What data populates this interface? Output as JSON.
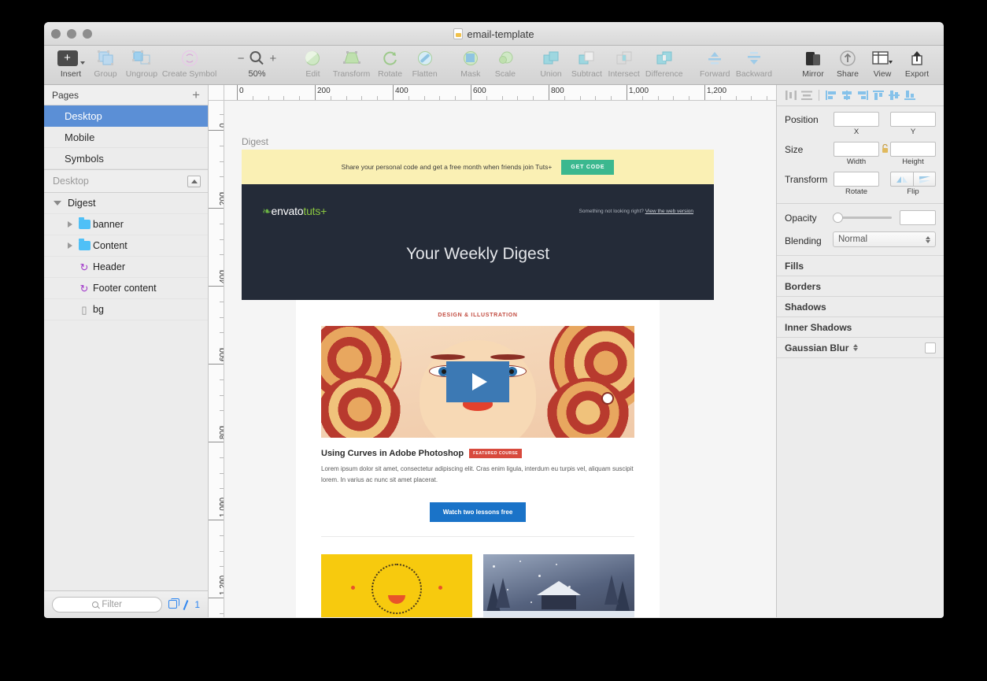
{
  "window": {
    "title": "email-template",
    "doc_icon": "sketch-document-icon"
  },
  "toolbar": {
    "items": [
      {
        "label": "Insert",
        "icon": "plus-insert-icon",
        "dim": false
      },
      {
        "label": "Group",
        "icon": "group-icon",
        "dim": true
      },
      {
        "label": "Ungroup",
        "icon": "ungroup-icon",
        "dim": true
      },
      {
        "label": "Create Symbol",
        "icon": "create-symbol-icon",
        "dim": true
      },
      {
        "label": "Edit",
        "icon": "edit-icon",
        "dim": true
      },
      {
        "label": "Transform",
        "icon": "transform-icon",
        "dim": true
      },
      {
        "label": "Rotate",
        "icon": "rotate-icon",
        "dim": true
      },
      {
        "label": "Flatten",
        "icon": "flatten-icon",
        "dim": true
      },
      {
        "label": "Mask",
        "icon": "mask-icon",
        "dim": true
      },
      {
        "label": "Scale",
        "icon": "scale-icon",
        "dim": true
      },
      {
        "label": "Union",
        "icon": "union-icon",
        "dim": true
      },
      {
        "label": "Subtract",
        "icon": "subtract-icon",
        "dim": true
      },
      {
        "label": "Intersect",
        "icon": "intersect-icon",
        "dim": true
      },
      {
        "label": "Difference",
        "icon": "difference-icon",
        "dim": true
      },
      {
        "label": "Forward",
        "icon": "forward-icon",
        "dim": true
      },
      {
        "label": "Backward",
        "icon": "backward-icon",
        "dim": true
      },
      {
        "label": "Mirror",
        "icon": "mirror-icon",
        "dim": false
      },
      {
        "label": "Share",
        "icon": "share-icon",
        "dim": false
      },
      {
        "label": "View",
        "icon": "view-icon",
        "dim": false
      },
      {
        "label": "Export",
        "icon": "export-icon",
        "dim": false
      }
    ],
    "zoom": {
      "minus": "−",
      "plus": "+",
      "level": "50%",
      "icon": "magnifier-icon"
    }
  },
  "sidebar": {
    "pages_header": "Pages",
    "add_page_label": "+",
    "pages": [
      {
        "label": "Desktop",
        "selected": true
      },
      {
        "label": "Mobile",
        "selected": false
      },
      {
        "label": "Symbols",
        "selected": false
      }
    ],
    "artboard_header": "Desktop",
    "layers": [
      {
        "label": "Digest",
        "icon": "artboard-icon",
        "disclosure": "open",
        "indent": 0
      },
      {
        "label": "banner",
        "icon": "folder-icon",
        "disclosure": "closed",
        "indent": 1
      },
      {
        "label": "Content",
        "icon": "folder-icon",
        "disclosure": "closed",
        "indent": 1
      },
      {
        "label": "Header",
        "icon": "symbol-icon",
        "disclosure": "none",
        "indent": 1
      },
      {
        "label": "Footer content",
        "icon": "symbol-icon",
        "disclosure": "none",
        "indent": 1
      },
      {
        "label": "bg",
        "icon": "bitmap-icon",
        "disclosure": "none",
        "indent": 1
      }
    ],
    "filter_placeholder": "Filter",
    "filter_count": "1"
  },
  "rulers": {
    "horizontal_labels": [
      "0",
      "200",
      "400",
      "600",
      "800",
      "1,000",
      "1,200"
    ],
    "vertical_labels": [
      "0",
      "200",
      "400",
      "600",
      "800",
      "1,000",
      "1,200"
    ]
  },
  "canvas": {
    "artboard_name": "Digest"
  },
  "email": {
    "promo": {
      "text": "Share your personal code and get a free month when friends join Tuts+",
      "button": "GET CODE",
      "bg_color": "#faf0b4",
      "button_color": "#3bb88f"
    },
    "header": {
      "logo_envato": "envato",
      "logo_tuts": "tuts+",
      "web_version_prefix": "Something not looking right? ",
      "web_version_link": "View the web version",
      "title": "Your Weekly Digest",
      "bg_color": "#242b38"
    },
    "feature": {
      "category": "DESIGN & ILLUSTRATION",
      "thumbnail_alt": "illustrated-portrait-thumbnail",
      "play_button": "play-icon",
      "title": "Using Curves in Adobe Photoshop",
      "badge": "FEATURED COURSE",
      "badge_color": "#d84a3d",
      "body": "Lorem ipsum dolor sit amet, consectetur adipiscing elit. Cras enim ligula, interdum eu turpis vel, aliquam suscipit lorem. In varius ac nunc sit amet placerat.",
      "cta": "Watch two lessons free",
      "cta_color": "#1a73c8"
    },
    "grid": [
      {
        "alt": "yellow-smiley-face-thumbnail",
        "bg_color": "#f7ca0e"
      },
      {
        "alt": "snowy-cabin-winter-thumbnail",
        "bg_color": "#55627e"
      }
    ]
  },
  "inspector": {
    "align_icons": [
      "align-distribute-horizontal-icon",
      "align-distribute-vertical-icon",
      "align-left-icon",
      "align-center-horizontal-icon",
      "align-right-icon",
      "align-top-icon",
      "align-middle-vertical-icon",
      "align-bottom-icon"
    ],
    "position": {
      "label": "Position",
      "x_value": "",
      "y_value": "",
      "x_sub": "X",
      "y_sub": "Y"
    },
    "size": {
      "label": "Size",
      "width_value": "",
      "height_value": "",
      "width_sub": "Width",
      "height_sub": "Height",
      "lock_icon": "unlocked-icon"
    },
    "transform": {
      "label": "Transform",
      "rotate_value": "",
      "rotate_sub": "Rotate",
      "flip_sub": "Flip",
      "flip_h_icon": "flip-horizontal-icon",
      "flip_v_icon": "flip-vertical-icon"
    },
    "opacity": {
      "label": "Opacity",
      "value": "",
      "slider_pct": 0
    },
    "blending": {
      "label": "Blending",
      "value": "Normal"
    },
    "sections": [
      {
        "label": "Fills",
        "has_stepper": false,
        "has_check": false
      },
      {
        "label": "Borders",
        "has_stepper": false,
        "has_check": false
      },
      {
        "label": "Shadows",
        "has_stepper": false,
        "has_check": false
      },
      {
        "label": "Inner Shadows",
        "has_stepper": false,
        "has_check": false
      },
      {
        "label": "Gaussian Blur",
        "has_stepper": true,
        "has_check": true
      }
    ]
  }
}
